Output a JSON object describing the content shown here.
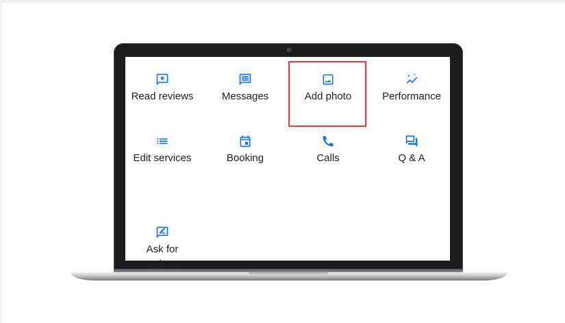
{
  "colors": {
    "icon": "#1a73e8",
    "highlight": "#e53935",
    "text": "#202124"
  },
  "actions": [
    {
      "label": "Read reviews",
      "icon": "review-star-icon"
    },
    {
      "label": "Messages",
      "icon": "message-icon"
    },
    {
      "label": "Add photo",
      "icon": "photo-icon"
    },
    {
      "label": "Performance",
      "icon": "performance-sparkle-icon"
    },
    {
      "label": "Edit services",
      "icon": "list-icon"
    },
    {
      "label": "Booking",
      "icon": "calendar-icon"
    },
    {
      "label": "Calls",
      "icon": "phone-icon"
    },
    {
      "label": "Q & A",
      "icon": "qa-icon"
    },
    {
      "label": "Ask for\nreviews",
      "icon": "edit-review-icon"
    }
  ]
}
